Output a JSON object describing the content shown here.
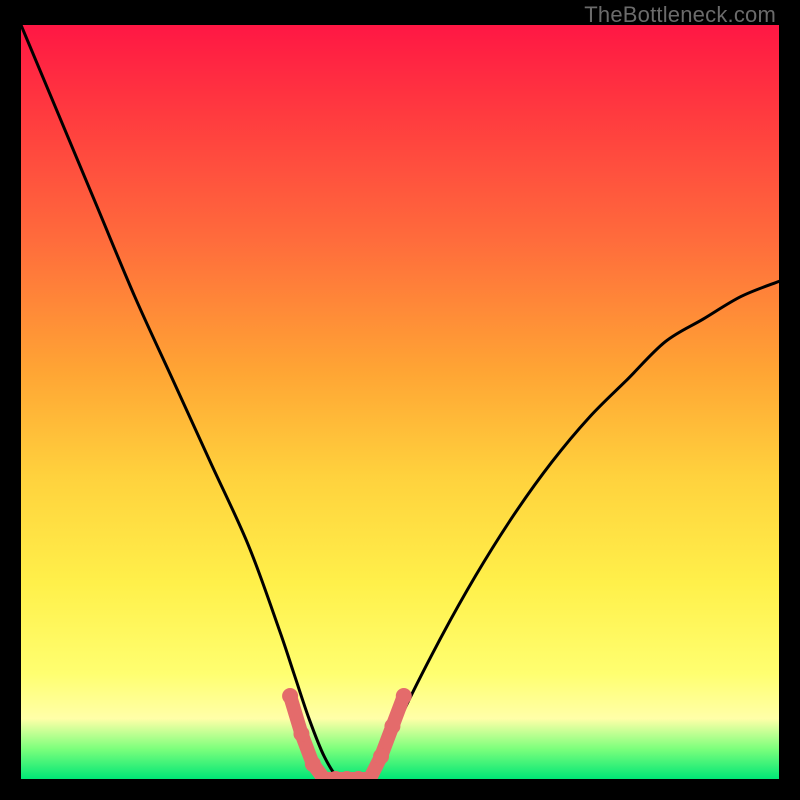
{
  "watermark": "TheBottleneck.com",
  "chart_data": {
    "type": "line",
    "title": "",
    "xlabel": "",
    "ylabel": "",
    "xlim": [
      0,
      100
    ],
    "ylim": [
      0,
      100
    ],
    "series": [
      {
        "name": "bottleneck-curve",
        "x": [
          0,
          5,
          10,
          15,
          20,
          25,
          30,
          34,
          36,
          38,
          40,
          42,
          44,
          46,
          48,
          50,
          55,
          60,
          65,
          70,
          75,
          80,
          85,
          90,
          95,
          100
        ],
        "y": [
          100,
          88,
          76,
          64,
          53,
          42,
          31,
          20,
          14,
          8,
          3,
          0,
          0,
          0,
          3,
          8,
          18,
          27,
          35,
          42,
          48,
          53,
          58,
          61,
          64,
          66
        ]
      }
    ],
    "flat_region": {
      "name": "optimal-range-markers",
      "color": "#e46b6b",
      "points": [
        {
          "x": 35.5,
          "y": 11
        },
        {
          "x": 37.0,
          "y": 6
        },
        {
          "x": 38.5,
          "y": 2
        },
        {
          "x": 40.0,
          "y": 0
        },
        {
          "x": 41.5,
          "y": 0
        },
        {
          "x": 43.0,
          "y": 0
        },
        {
          "x": 44.5,
          "y": 0
        },
        {
          "x": 46.0,
          "y": 0
        },
        {
          "x": 47.5,
          "y": 3
        },
        {
          "x": 49.0,
          "y": 7
        },
        {
          "x": 50.5,
          "y": 11
        }
      ]
    },
    "background": {
      "top_color": "#ff1744",
      "mid_color": "#fff04a",
      "bottom_color": "#00e676"
    }
  }
}
